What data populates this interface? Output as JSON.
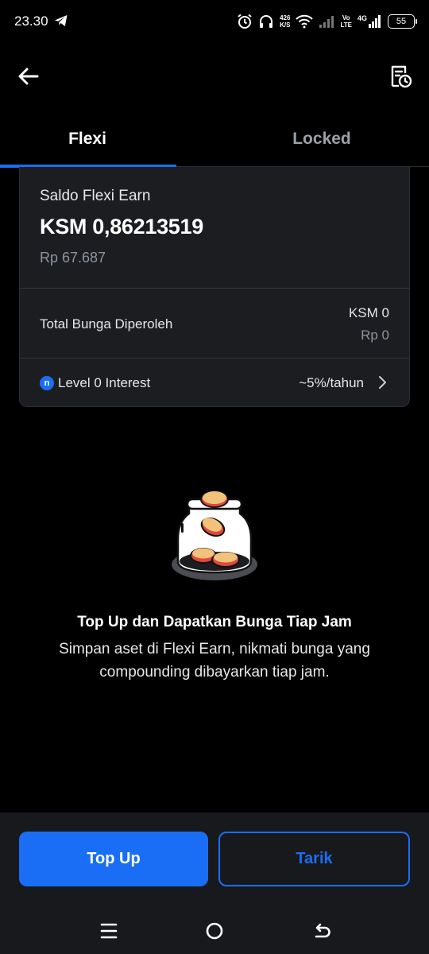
{
  "status_bar": {
    "time": "23.30",
    "speed_value": "426",
    "speed_unit": "K/S",
    "volte_line1": "Vo",
    "volte_line2": "LTE",
    "network_type": "4G",
    "battery": "55"
  },
  "tabs": [
    {
      "label": "Flexi",
      "active": true
    },
    {
      "label": "Locked",
      "active": false
    }
  ],
  "balance": {
    "label": "Saldo Flexi Earn",
    "amount": "KSM 0,86213519",
    "fiat": "Rp 67.687"
  },
  "interest": {
    "label": "Total Bunga Diperoleh",
    "ksm": "KSM 0",
    "rp": "Rp 0"
  },
  "level": {
    "icon_letter": "n",
    "label": "Level 0 Interest",
    "rate": "~5%/tahun"
  },
  "empty_state": {
    "title": "Top Up dan Dapatkan Bunga Tiap Jam",
    "description": "Simpan aset di Flexi Earn, nikmati bunga yang compounding dibayarkan tiap jam."
  },
  "actions": {
    "topup_label": "Top Up",
    "tarik_label": "Tarik"
  },
  "colors": {
    "accent": "#1a6ef5",
    "background": "#000000",
    "card": "#1b1d21",
    "coin": "#f3c27a",
    "coin_rim": "#e0483a"
  }
}
